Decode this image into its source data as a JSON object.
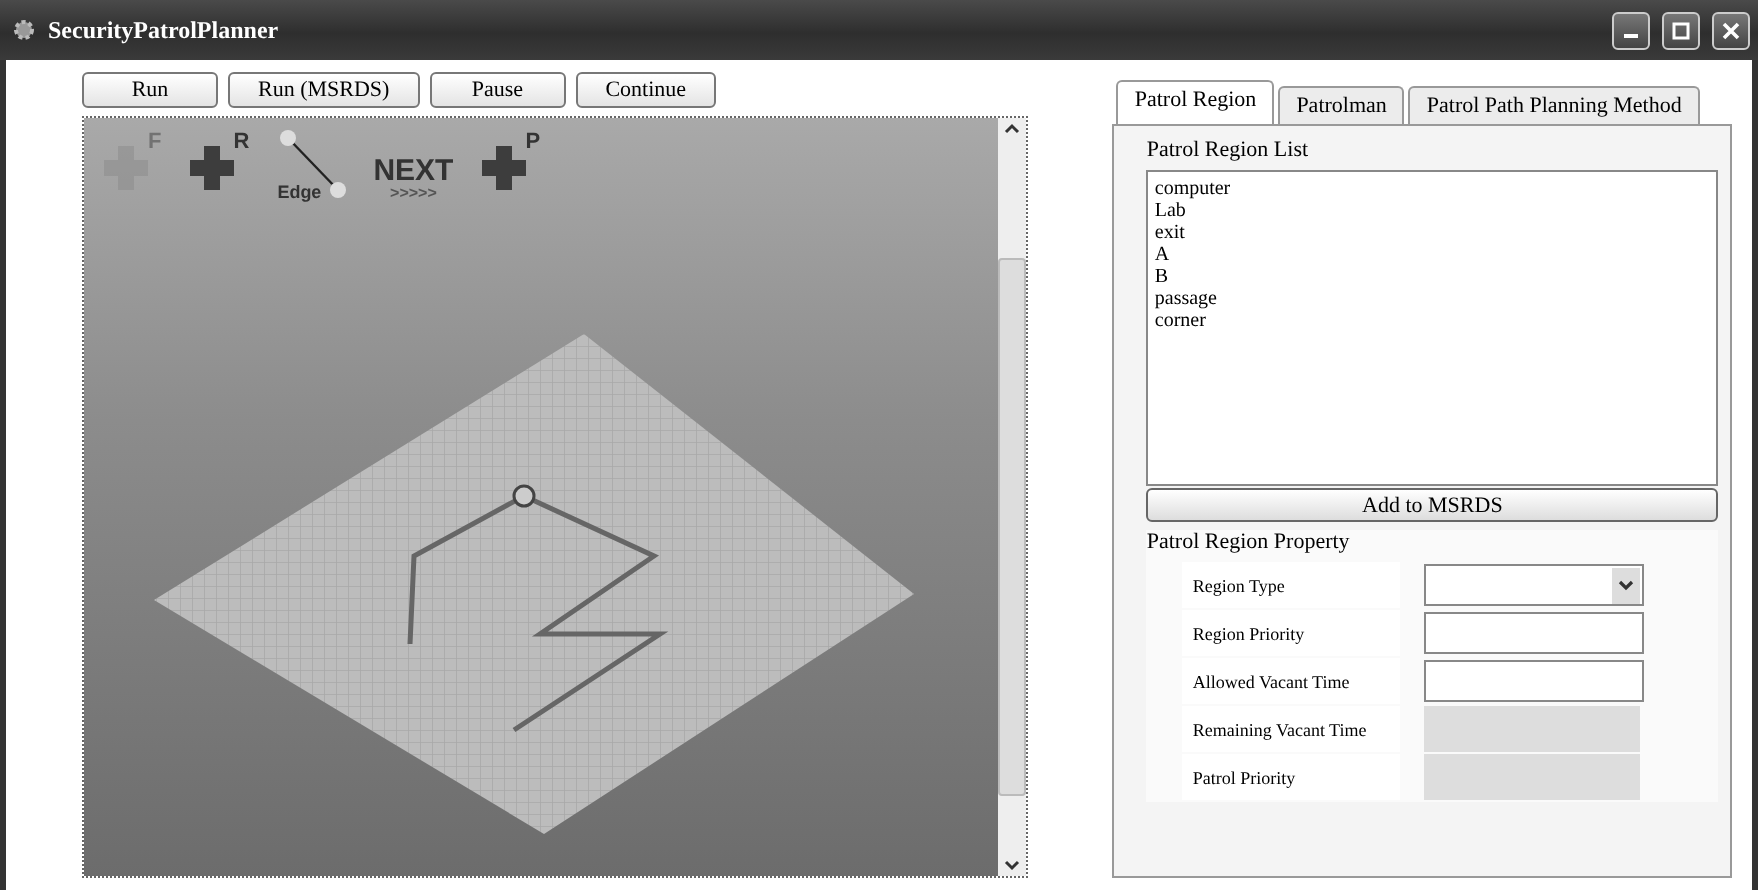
{
  "window": {
    "title": "SecurityPatrolPlanner"
  },
  "buttons": [
    "Run",
    "Run (MSRDS)",
    "Pause",
    "Continue"
  ],
  "tools": [
    {
      "kind": "plus",
      "label": "F",
      "disabled": true
    },
    {
      "kind": "plus",
      "label": "R",
      "disabled": false
    },
    {
      "kind": "edge",
      "label": "Edge",
      "disabled": false
    },
    {
      "kind": "next",
      "label": "NEXT",
      "sublabel": ">>>>>",
      "disabled": false
    },
    {
      "kind": "plus",
      "label": "P",
      "disabled": false
    }
  ],
  "tabs": [
    {
      "label": "Patrol Region",
      "selected": true
    },
    {
      "label": "Patrolman",
      "selected": false
    },
    {
      "label": "Patrol Path Planning Method",
      "selected": false
    }
  ],
  "region_list": {
    "title": "Patrol Region List",
    "items": [
      "computer",
      "Lab",
      "exit",
      "A",
      "B",
      "passage",
      "corner"
    ],
    "button": "Add to MSRDS"
  },
  "property": {
    "title": "Patrol Region Property",
    "rows": [
      {
        "label": "Region Type",
        "kind": "combo"
      },
      {
        "label": "Region Priority",
        "kind": "text"
      },
      {
        "label": "Allowed Vacant Time",
        "kind": "text"
      },
      {
        "label": "Remaining Vacant Time",
        "kind": "readonly"
      },
      {
        "label": "Patrol Priority",
        "kind": "readonly"
      }
    ]
  }
}
